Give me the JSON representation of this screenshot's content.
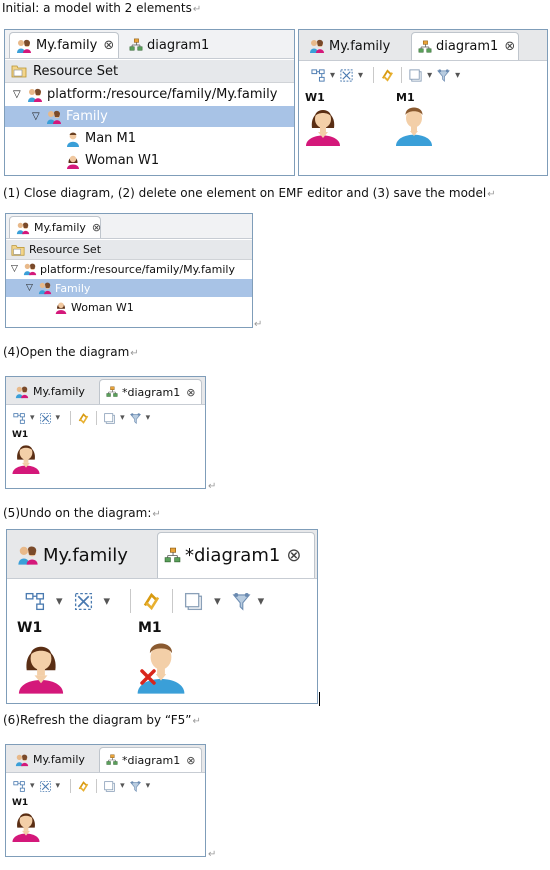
{
  "captions": {
    "c0": "Initial:  a model with 2 elements",
    "c1": "(1) Close diagram, (2) delete one element on EMF editor and (3) save the model",
    "c2": "(4)Open the diagram",
    "c3": "(5)Undo on the diagram:",
    "c4": "(6)Refresh the diagram by “F5”"
  },
  "para_mark": "↵",
  "tabs": {
    "model_tab": "My.family",
    "diagram_tab": "diagram1",
    "diagram_tab_dirty": "*diagram1",
    "close_glyph": "⊗"
  },
  "tree": {
    "root": "Resource Set",
    "resource": "platform:/resource/family/My.family",
    "family": "Family",
    "man": "Man M1",
    "woman": "Woman W1",
    "expanded_glyph": "▽"
  },
  "diagram": {
    "woman_label": "W1",
    "man_label": "M1"
  },
  "toolbar": {
    "dropdown_glyph": "▾"
  },
  "colors": {
    "selection": "#a8c3e6",
    "woman_pink": "#d4187a",
    "man_blue": "#3a9fd8",
    "error_red": "#d9261c"
  }
}
